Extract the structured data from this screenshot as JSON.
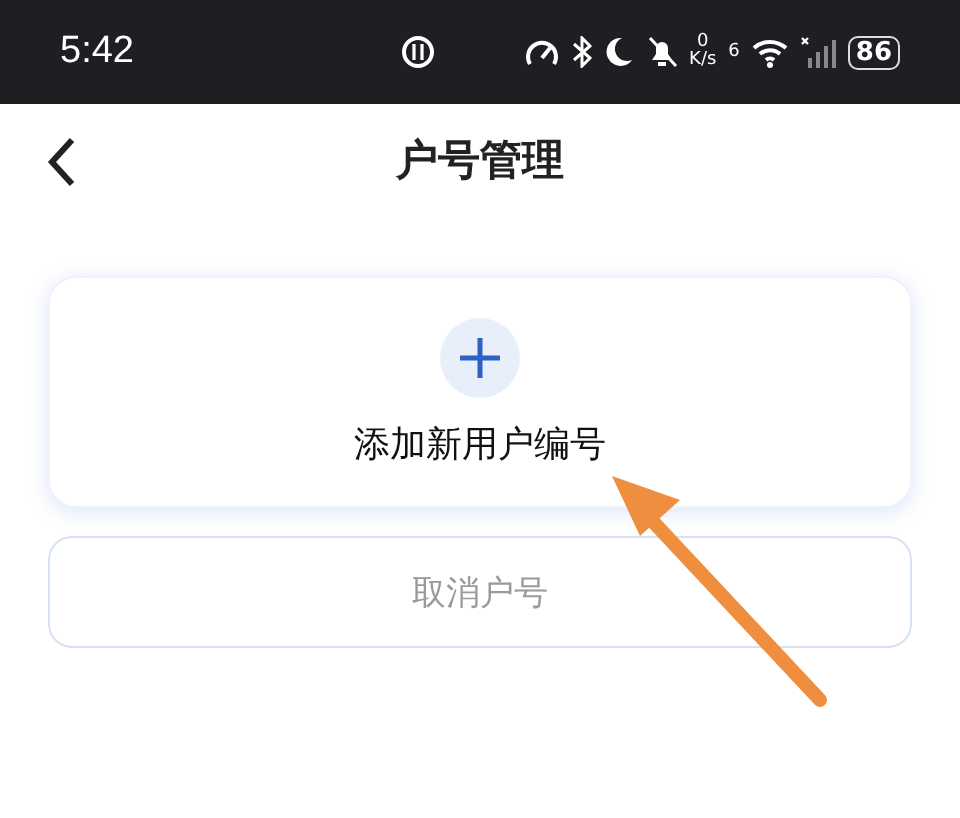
{
  "status_bar": {
    "time": "5:42",
    "net_speed_value": "0",
    "net_speed_unit": "K/s",
    "wifi_label": "6",
    "battery": "86"
  },
  "header": {
    "title": "户号管理"
  },
  "add_card": {
    "label": "添加新用户编号"
  },
  "cancel_button": {
    "label": "取消户号",
    "disabled": true
  }
}
